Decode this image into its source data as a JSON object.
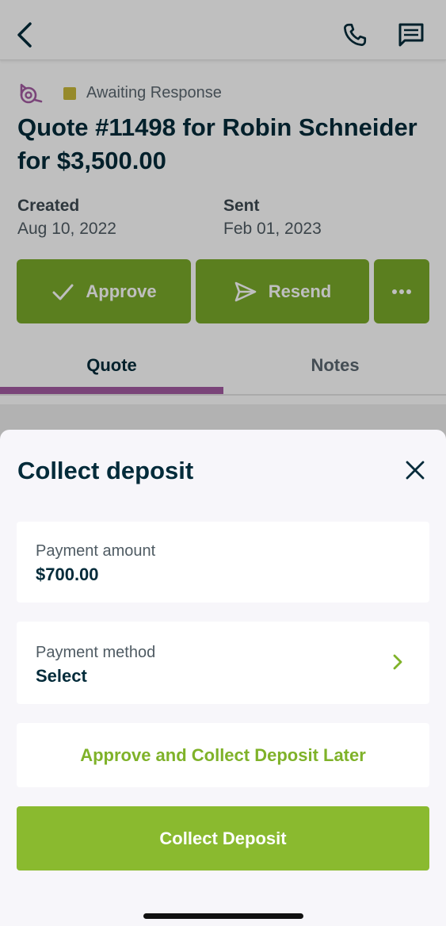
{
  "header": {
    "back_icon": "chevron-left-icon",
    "phone_icon": "phone-icon",
    "message_icon": "message-icon"
  },
  "quote": {
    "status_icon": "quote-measure-icon",
    "status_color": "#c8b93a",
    "status_text": "Awaiting Response",
    "title": "Quote #11498 for Robin Schneider for $3,500.00",
    "created_label": "Created",
    "created_date": "Aug 10, 2022",
    "sent_label": "Sent",
    "sent_date": "Feb 01, 2023"
  },
  "actions": {
    "approve_label": "Approve",
    "resend_label": "Resend",
    "more_icon": "more-icon",
    "accent_color": "#7aaa2a"
  },
  "tabs": [
    {
      "label": "Quote",
      "active": true
    },
    {
      "label": "Notes",
      "active": false
    }
  ],
  "sheet": {
    "title": "Collect deposit",
    "close_icon": "close-icon",
    "payment_amount_label": "Payment amount",
    "payment_amount_value": "$700.00",
    "payment_method_label": "Payment method",
    "payment_method_value": "Select",
    "secondary_button": "Approve and Collect Deposit Later",
    "primary_button": "Collect Deposit",
    "primary_color": "#8aba2f"
  }
}
